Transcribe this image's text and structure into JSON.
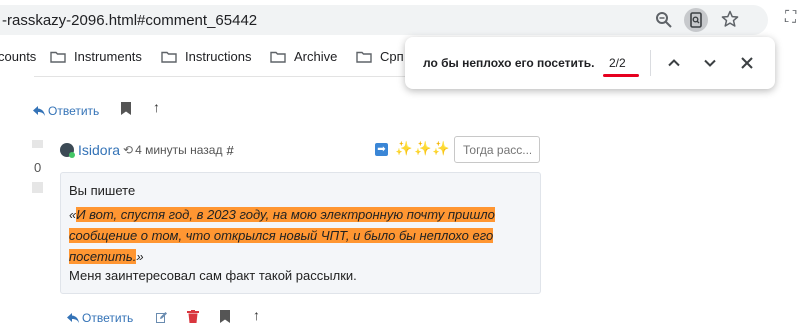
{
  "browser": {
    "url": "-rasskazy-2096.html#comment_65442",
    "bookmarks": [
      {
        "label": "counts",
        "has_folder": false
      },
      {
        "label": "Instruments",
        "has_folder": true
      },
      {
        "label": "Instructions",
        "has_folder": true
      },
      {
        "label": "Archive",
        "has_folder": true
      },
      {
        "label": "Срп",
        "has_folder": true
      }
    ]
  },
  "find_bar": {
    "query": "ло бы неплохо его посетить.",
    "count": "2/2",
    "underline_color": "#e6001f"
  },
  "page": {
    "prev_reply_label": "Ответить",
    "comment": {
      "votes": "0",
      "author": "Isidora",
      "time": "4 минуты назад",
      "hash": "#",
      "date_placeholder": "Тогда расс...",
      "intro": "Вы пишете",
      "quote_open": "«",
      "quote_highlight": "И вот, спустя год, в 2023 году, на мою электронную почту пришло сообщение о том, что открылся новый ЧПТ, и было бы неплохо его посетить.",
      "quote_close": "»",
      "outro": "Меня заинтересовал сам факт такой рассылки.",
      "reply_label": "Ответить",
      "highlight_color": "#ff9632"
    }
  }
}
